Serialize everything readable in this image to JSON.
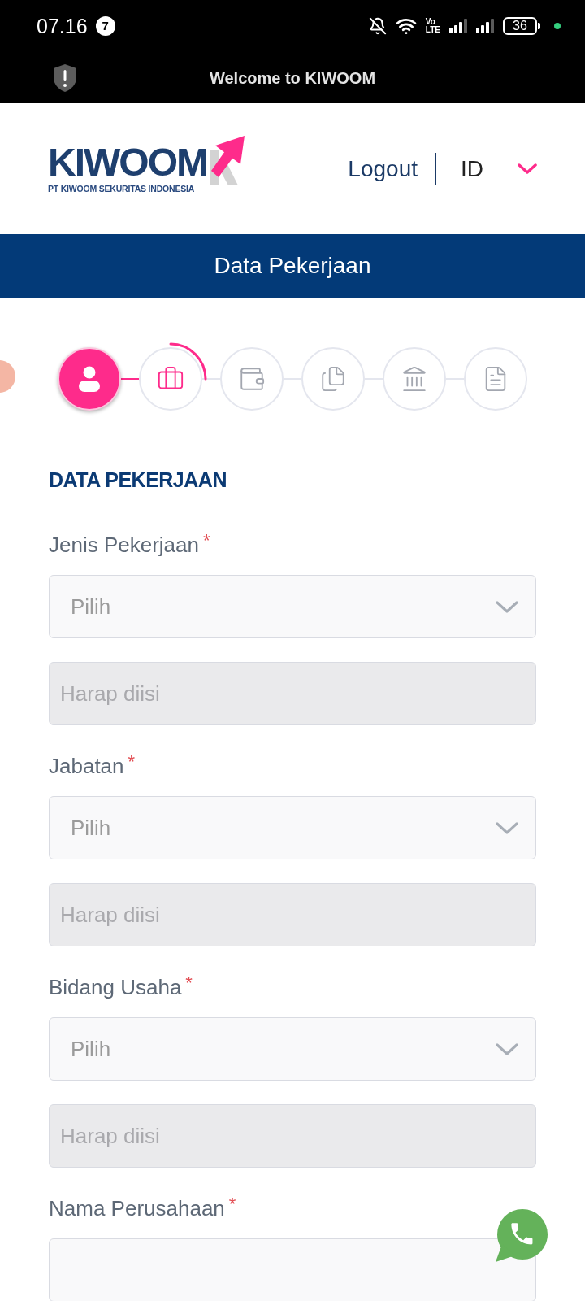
{
  "status_bar": {
    "time": "07.16",
    "notification_count": "7",
    "network_top": "Vo",
    "network_bottom": "LTE",
    "battery": "36"
  },
  "notification_bar": {
    "text": "Welcome to KIWOOM"
  },
  "header": {
    "logo_name": "KIWOOM",
    "logo_tagline": "PT KIWOOM SEKURITAS INDONESIA",
    "logout": "Logout",
    "language": "ID"
  },
  "title_bar": {
    "title": "Data Pekerjaan"
  },
  "stepper": {
    "steps": [
      {
        "kind": "person",
        "completed": true,
        "selected": false
      },
      {
        "kind": "briefcase",
        "completed": false,
        "selected": true
      },
      {
        "kind": "wallet",
        "completed": false,
        "selected": false
      },
      {
        "kind": "documents",
        "completed": false,
        "selected": false
      },
      {
        "kind": "bank",
        "completed": false,
        "selected": false
      },
      {
        "kind": "document",
        "completed": false,
        "selected": false
      }
    ]
  },
  "form": {
    "title": "DATA PEKERJAAN",
    "fields": [
      {
        "label": "Jenis Pekerjaan",
        "required_mark": "*",
        "controls": [
          {
            "kind": "select",
            "placeholder": "Pilih",
            "disabled": false
          },
          {
            "kind": "input",
            "placeholder": "Harap diisi",
            "disabled": true
          }
        ]
      },
      {
        "label": "Jabatan",
        "required_mark": "*",
        "controls": [
          {
            "kind": "select",
            "placeholder": "Pilih",
            "disabled": false
          },
          {
            "kind": "input",
            "placeholder": "Harap diisi",
            "disabled": true
          }
        ]
      },
      {
        "label": "Bidang Usaha",
        "required_mark": "*",
        "controls": [
          {
            "kind": "select",
            "placeholder": "Pilih",
            "disabled": false
          },
          {
            "kind": "input",
            "placeholder": "Harap diisi",
            "disabled": true
          }
        ]
      },
      {
        "label": "Nama Perusahaan",
        "required_mark": "*",
        "controls": [
          {
            "kind": "input",
            "disabled": false
          }
        ]
      }
    ]
  }
}
